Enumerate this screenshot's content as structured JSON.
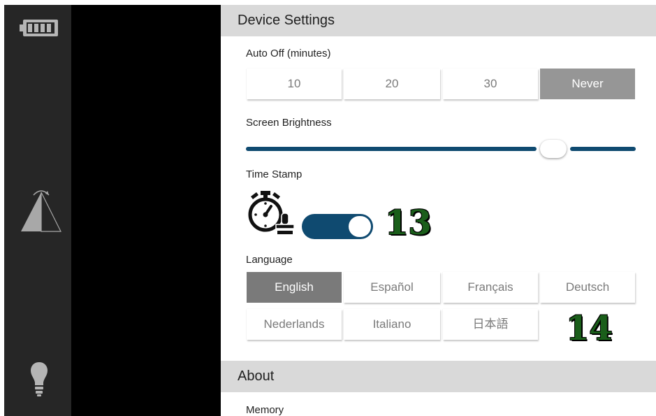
{
  "device_settings": {
    "title": "Device Settings",
    "auto_off": {
      "label": "Auto Off (minutes)",
      "options": [
        "10",
        "20",
        "30",
        "Never"
      ],
      "selected": "Never"
    },
    "screen_brightness": {
      "label": "Screen Brightness",
      "level_percent": 81
    },
    "time_stamp": {
      "label": "Time Stamp",
      "enabled": true
    },
    "language": {
      "label": "Language",
      "options": [
        "English",
        "Español",
        "Français",
        "Deutsch",
        "Nederlands",
        "Italiano",
        "日本語"
      ],
      "selected": "English"
    }
  },
  "about": {
    "title": "About",
    "memory_label": "Memory"
  },
  "annotations": [
    "13",
    "14"
  ],
  "icons": {
    "rail": [
      "battery-icon",
      "view-angle-icon",
      "lightbulb-icon"
    ],
    "time_stamp": "stopwatch-stamp-icon"
  },
  "colors": {
    "accent": "#0f4a70",
    "selected_segment": "#969696",
    "selected_language": "#7a7a7a",
    "section_header": "#d9d9d9",
    "annotation_green": "#1a5e1a"
  }
}
